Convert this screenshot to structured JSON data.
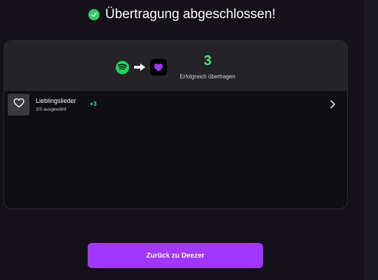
{
  "header": {
    "title": "Übertragung abgeschlossen!",
    "status_icon": "check-circle-icon",
    "status_color": "#35c96a"
  },
  "transfer": {
    "source_icon": "spotify-icon",
    "arrow_icon": "arrow-right-icon",
    "target_icon": "deezer-icon",
    "count": "3",
    "count_label": "Erfolgreich übertragen",
    "count_color": "#4be37a"
  },
  "playlists": [
    {
      "name": "Lieblingslieder",
      "subtitle": "3/3 ausgewählt",
      "badge": "+3",
      "thumb_icon": "heart-icon",
      "action_icon": "chevron-right-icon"
    }
  ],
  "actions": {
    "back_label": "Zurück zu Deezer",
    "accent_color": "#a238ff"
  }
}
